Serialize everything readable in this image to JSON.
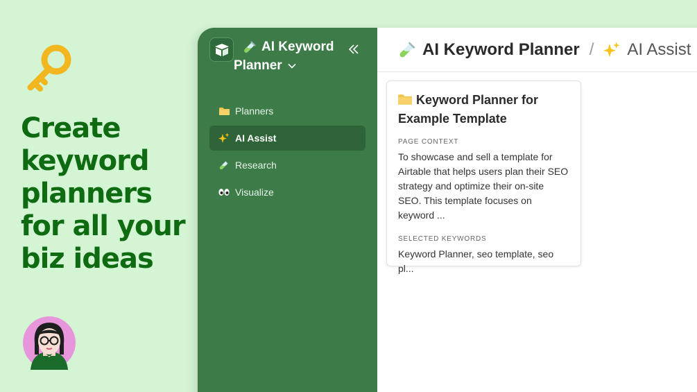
{
  "promo": {
    "headline": [
      "Create",
      "keyword",
      "planners",
      "for all your",
      "biz ideas"
    ]
  },
  "sidebar": {
    "workspace_title_line1": "AI Keyword",
    "workspace_title_line2": "Planner",
    "items": [
      {
        "label": "Planners",
        "icon": "folder-icon",
        "active": false
      },
      {
        "label": "AI Assist",
        "icon": "sparkles-icon",
        "active": true
      },
      {
        "label": "Research",
        "icon": "test-tube-icon",
        "active": false
      },
      {
        "label": "Visualize",
        "icon": "eyes-icon",
        "active": false
      }
    ]
  },
  "breadcrumb": {
    "page": "AI Keyword Planner",
    "separator": "/",
    "section": "AI Assist"
  },
  "card": {
    "title": "Keyword Planner for Example Template",
    "context_label": "PAGE CONTEXT",
    "context_text": "To showcase and sell a template for Airtable that helps users plan their SEO strategy and optimize their on-site SEO. This template focuses on keyword ...",
    "keywords_label": "SELECTED KEYWORDS",
    "keywords_text": "Keyword Planner, seo template, seo pl..."
  },
  "colors": {
    "background": "#d3f5d4",
    "headline": "#0f6b12",
    "sidebar": "#3d7c48",
    "sidebar_active": "#2e6437",
    "key": "#f2b61e"
  }
}
